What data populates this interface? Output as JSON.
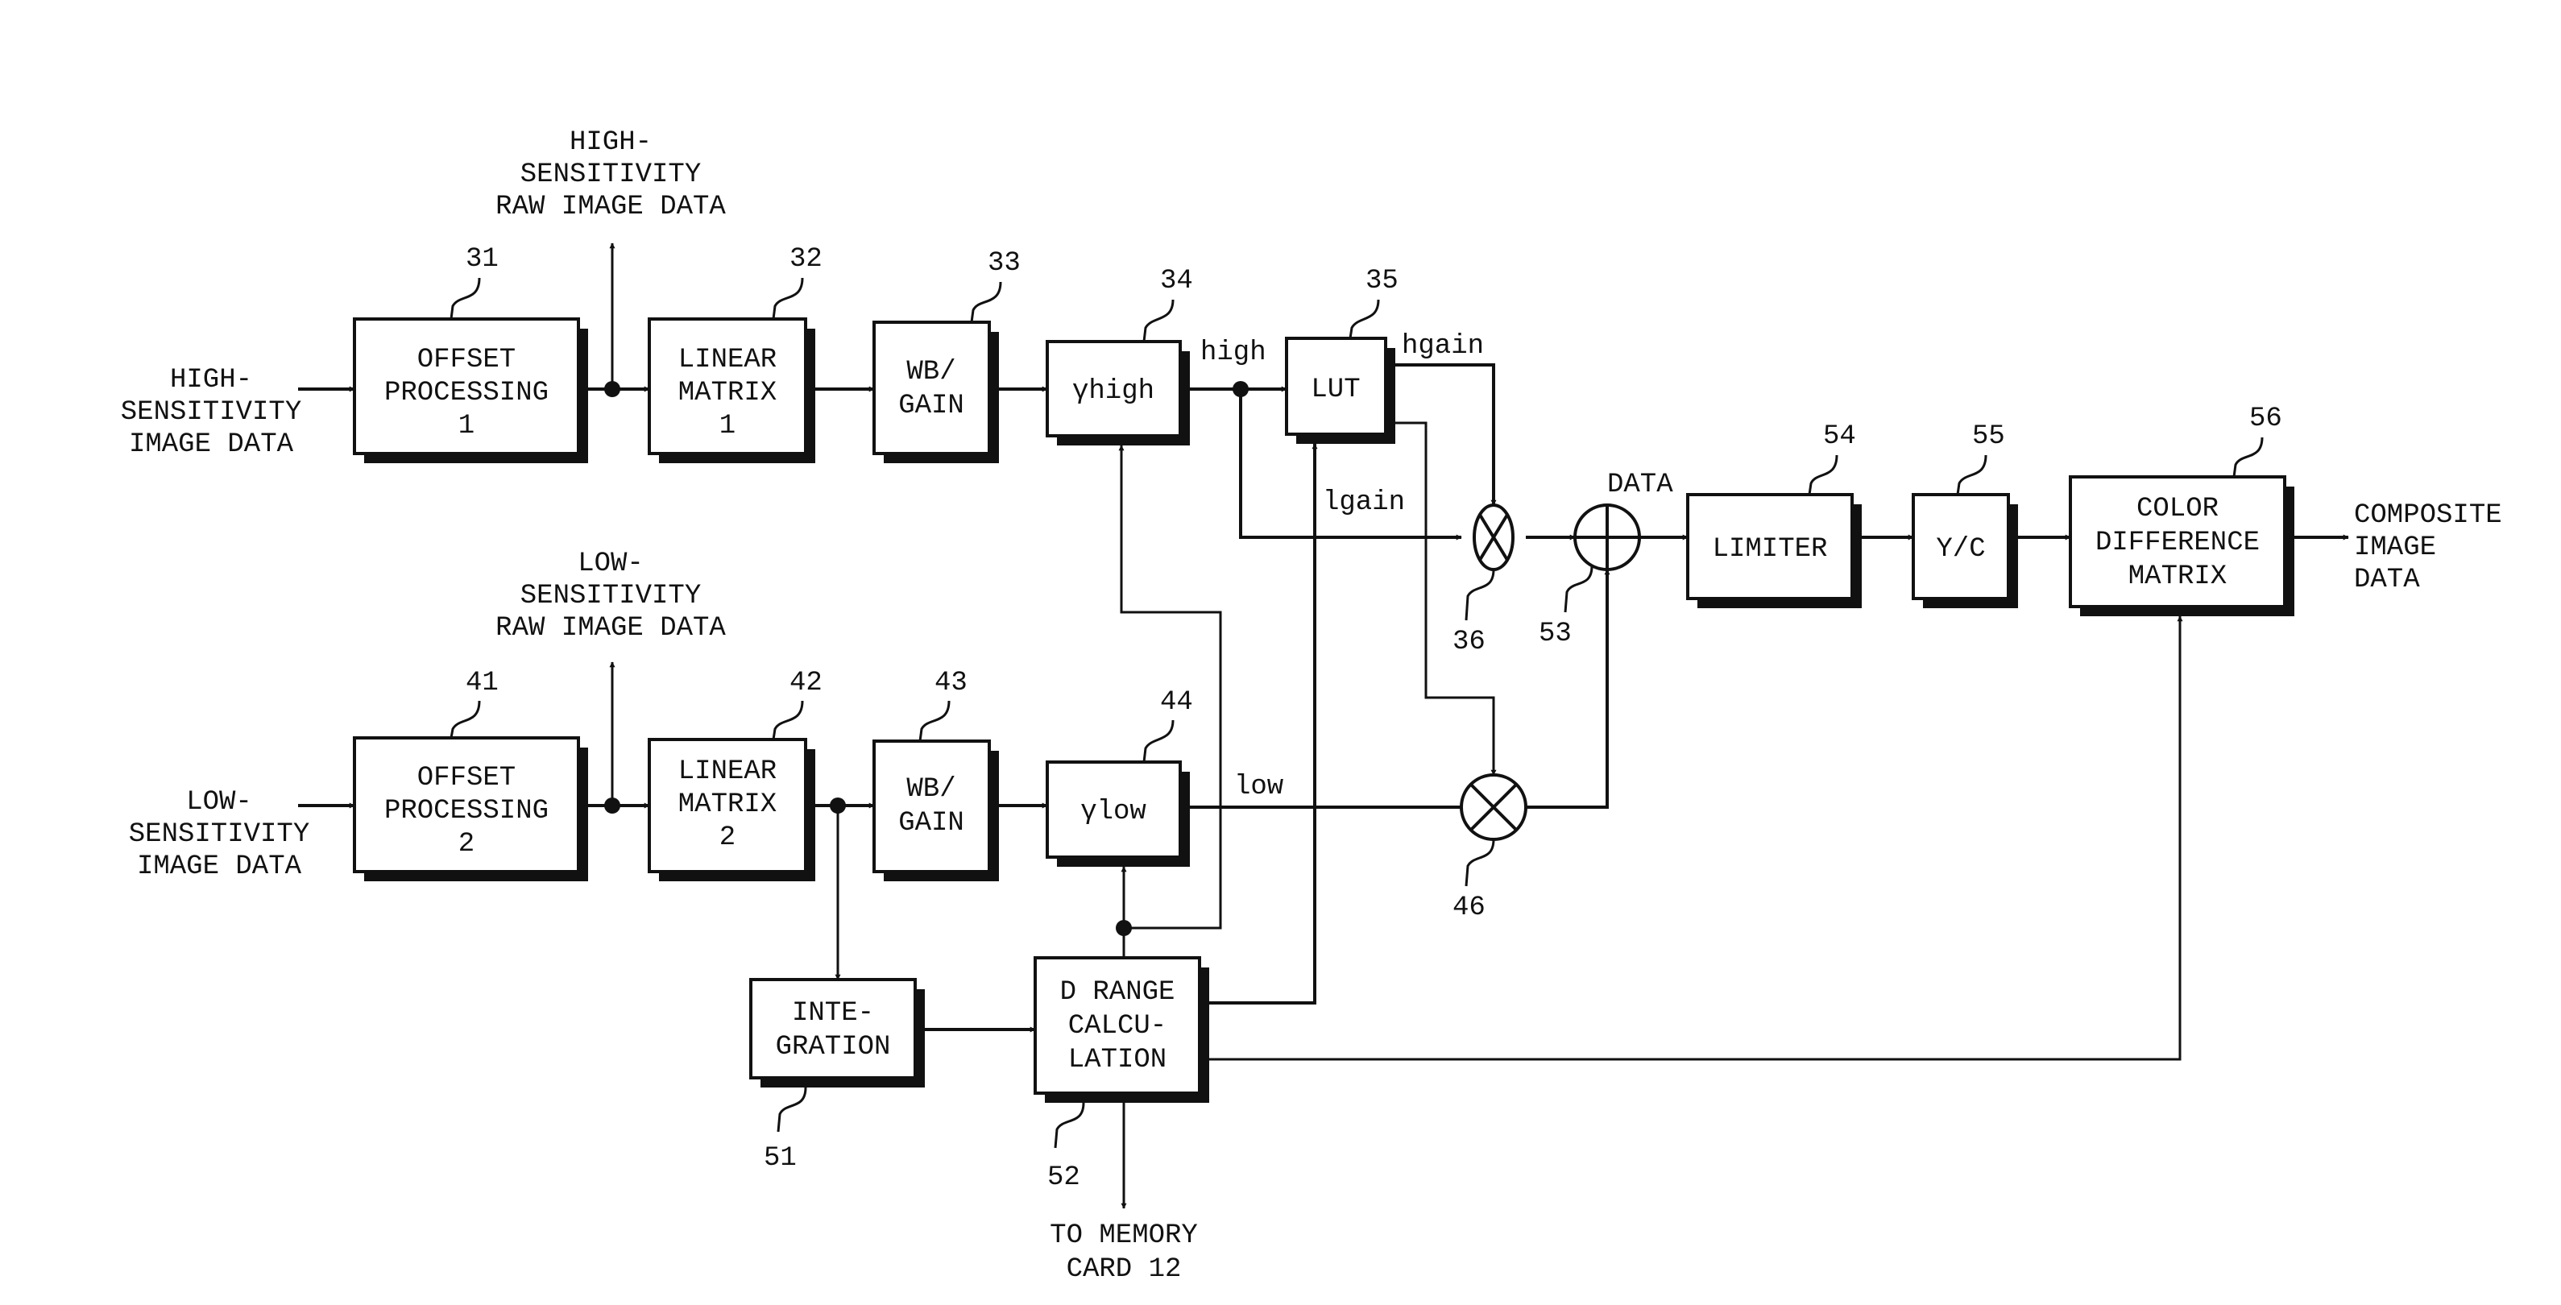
{
  "diagram": {
    "type": "block-diagram",
    "blocks": [
      {
        "id": "31",
        "ref": "31",
        "lines": [
          "OFFSET",
          "PROCESSING",
          "1"
        ]
      },
      {
        "id": "32",
        "ref": "32",
        "lines": [
          "LINEAR",
          "MATRIX",
          "1"
        ]
      },
      {
        "id": "33",
        "ref": "33",
        "lines": [
          "WB/",
          "GAIN"
        ]
      },
      {
        "id": "34",
        "ref": "34",
        "lines": [
          "γhigh"
        ]
      },
      {
        "id": "35",
        "ref": "35",
        "lines": [
          "LUT"
        ]
      },
      {
        "id": "41",
        "ref": "41",
        "lines": [
          "OFFSET",
          "PROCESSING",
          "2"
        ]
      },
      {
        "id": "42",
        "ref": "42",
        "lines": [
          "LINEAR",
          "MATRIX",
          "2"
        ]
      },
      {
        "id": "43",
        "ref": "43",
        "lines": [
          "WB/",
          "GAIN"
        ]
      },
      {
        "id": "44",
        "ref": "44",
        "lines": [
          "γlow"
        ]
      },
      {
        "id": "51",
        "ref": "51",
        "lines": [
          "INTE-",
          "GRATION"
        ]
      },
      {
        "id": "52",
        "ref": "52",
        "lines": [
          "D RANGE",
          "CALCU-",
          "LATION"
        ]
      },
      {
        "id": "54",
        "ref": "54",
        "lines": [
          "LIMITER"
        ]
      },
      {
        "id": "55",
        "ref": "55",
        "lines": [
          "Y/C"
        ]
      },
      {
        "id": "56",
        "ref": "56",
        "lines": [
          "COLOR",
          "DIFFERENCE",
          "MATRIX"
        ]
      }
    ],
    "operators": [
      {
        "id": "36",
        "ref": "36",
        "op": "multiply"
      },
      {
        "id": "46",
        "ref": "46",
        "op": "multiply"
      },
      {
        "id": "53",
        "ref": "53",
        "op": "add"
      }
    ],
    "io_labels": {
      "high_input": [
        "HIGH-",
        "SENSITIVITY",
        "IMAGE DATA"
      ],
      "low_input": [
        "LOW-",
        "SENSITIVITY",
        "IMAGE DATA"
      ],
      "high_raw": [
        "HIGH-",
        "SENSITIVITY",
        "RAW IMAGE DATA"
      ],
      "low_raw": [
        "LOW-",
        "SENSITIVITY",
        "RAW IMAGE DATA"
      ],
      "output": [
        "COMPOSITE",
        "IMAGE",
        "DATA"
      ],
      "memory": [
        "TO MEMORY",
        "CARD 12"
      ]
    },
    "signal_labels": {
      "high": "high",
      "low": "low",
      "hgain": "hgain",
      "lgain": "lgain",
      "data": "DATA"
    }
  }
}
